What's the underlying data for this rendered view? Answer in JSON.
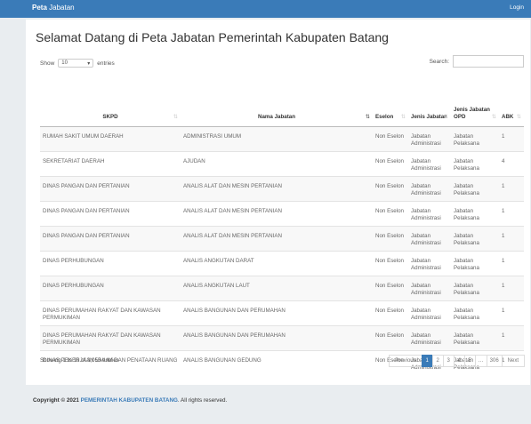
{
  "navbar": {
    "brand_bold": "Peta",
    "brand_rest": " Jabatan",
    "login": "Login"
  },
  "page": {
    "title": "Selamat Datang di Peta Jabatan Pemerintah Kabupaten Batang"
  },
  "length": {
    "show": "Show",
    "value": "10",
    "entries": "entries"
  },
  "search": {
    "label": "Search:",
    "value": ""
  },
  "table": {
    "headers": [
      "SKPD",
      "Nama Jabatan",
      "Eselon",
      "Jenis Jabatan",
      "Jenis Jabatan OPD",
      "ABK"
    ],
    "rows": [
      [
        "RUMAH SAKIT UMUM DAERAH",
        "ADMINISTRASI UMUM",
        "Non Eselon",
        "Jabatan Administrasi",
        "Jabatan Pelaksana",
        "1"
      ],
      [
        "SEKRETARIAT DAERAH",
        "AJUDAN",
        "Non Eselon",
        "Jabatan Administrasi",
        "Jabatan Pelaksana",
        "4"
      ],
      [
        "DINAS PANGAN DAN PERTANIAN",
        "ANALIS ALAT DAN MESIN PERTANIAN",
        "Non Eselon",
        "Jabatan Administrasi",
        "Jabatan Pelaksana",
        "1"
      ],
      [
        "DINAS PANGAN DAN PERTANIAN",
        "ANALIS ALAT DAN MESIN PERTANIAN",
        "Non Eselon",
        "Jabatan Administrasi",
        "Jabatan Pelaksana",
        "1"
      ],
      [
        "DINAS PANGAN DAN PERTANIAN",
        "ANALIS ALAT DAN MESIN PERTANIAN",
        "Non Eselon",
        "Jabatan Administrasi",
        "Jabatan Pelaksana",
        "1"
      ],
      [
        "DINAS PERHUBUNGAN",
        "ANALIS ANGKUTAN DARAT",
        "Non Eselon",
        "Jabatan Administrasi",
        "Jabatan Pelaksana",
        "1"
      ],
      [
        "DINAS PERHUBUNGAN",
        "ANALIS ANGKUTAN LAUT",
        "Non Eselon",
        "Jabatan Administrasi",
        "Jabatan Pelaksana",
        "1"
      ],
      [
        "DINAS PERUMAHAN RAKYAT DAN KAWASAN PERMUKIMAN",
        "ANALIS BANGUNAN DAN PERUMAHAN",
        "Non Eselon",
        "Jabatan Administrasi",
        "Jabatan Pelaksana",
        "1"
      ],
      [
        "DINAS PERUMAHAN RAKYAT DAN KAWASAN PERMUKIMAN",
        "ANALIS BANGUNAN DAN PERUMAHAN",
        "Non Eselon",
        "Jabatan Administrasi",
        "Jabatan Pelaksana",
        "1"
      ],
      [
        "DINAS PEKERJAAN UMUM DAN PENATAAN RUANG",
        "ANALIS BANGUNAN GEDUNG",
        "Non Eselon",
        "Jabatan Administrasi",
        "Jabatan Pelaksana",
        "1"
      ]
    ]
  },
  "info": "Showing 1 to 10 of 3,055 entries",
  "pagination": [
    "Previous",
    "1",
    "2",
    "3",
    "4",
    "5",
    "…",
    "306",
    "Next"
  ],
  "footer": {
    "prefix": "Copyright © 2021 ",
    "org": "PEMERINTAH KABUPATEN BATANG",
    "suffix": ". All rights reserved."
  }
}
